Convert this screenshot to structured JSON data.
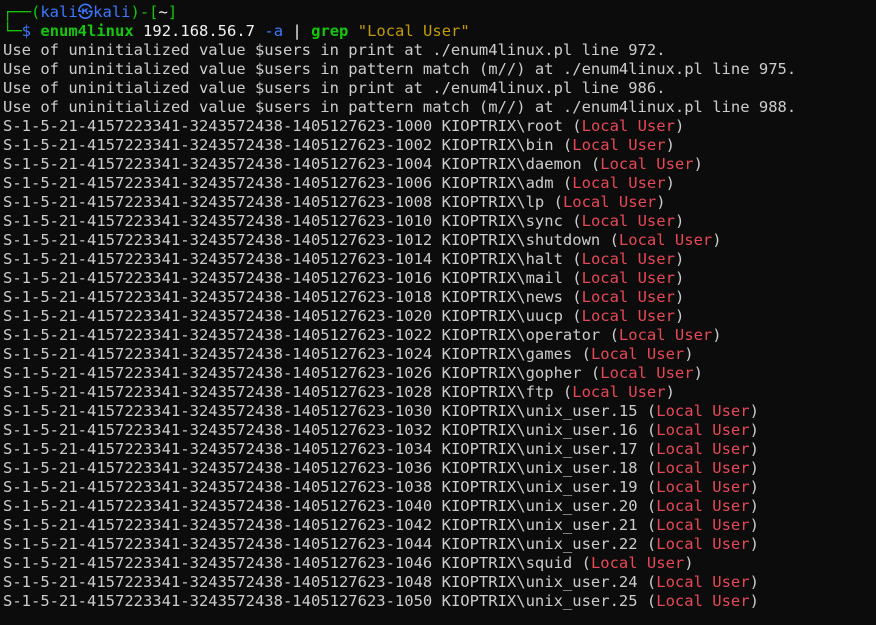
{
  "prompt": {
    "line1_prefix": "┌──(",
    "user": "kali",
    "at_symbol": "㉿",
    "host": "kali",
    "line1_mid": ")-[",
    "cwd": "~",
    "line1_suffix": "]",
    "line2_prefix": "└─",
    "dollar": "$",
    "cmd": "enum4linux",
    "arg_ip": "192.168.56.7",
    "arg_flag": "-a",
    "pipe": "|",
    "grep": "grep",
    "grep_pattern": "\"Local User\""
  },
  "warnings": [
    "Use of uninitialized value $users in print at ./enum4linux.pl line 972.",
    "Use of uninitialized value $users in pattern match (m//) at ./enum4linux.pl line 975.",
    "Use of uninitialized value $users in print at ./enum4linux.pl line 986.",
    "Use of uninitialized value $users in pattern match (m//) at ./enum4linux.pl line 988."
  ],
  "local_user_label": "Local User",
  "users": [
    {
      "sid": "S-1-5-21-4157223341-3243572438-1405127623-1000",
      "name": "KIOPTRIX\\root"
    },
    {
      "sid": "S-1-5-21-4157223341-3243572438-1405127623-1002",
      "name": "KIOPTRIX\\bin"
    },
    {
      "sid": "S-1-5-21-4157223341-3243572438-1405127623-1004",
      "name": "KIOPTRIX\\daemon"
    },
    {
      "sid": "S-1-5-21-4157223341-3243572438-1405127623-1006",
      "name": "KIOPTRIX\\adm"
    },
    {
      "sid": "S-1-5-21-4157223341-3243572438-1405127623-1008",
      "name": "KIOPTRIX\\lp"
    },
    {
      "sid": "S-1-5-21-4157223341-3243572438-1405127623-1010",
      "name": "KIOPTRIX\\sync"
    },
    {
      "sid": "S-1-5-21-4157223341-3243572438-1405127623-1012",
      "name": "KIOPTRIX\\shutdown"
    },
    {
      "sid": "S-1-5-21-4157223341-3243572438-1405127623-1014",
      "name": "KIOPTRIX\\halt"
    },
    {
      "sid": "S-1-5-21-4157223341-3243572438-1405127623-1016",
      "name": "KIOPTRIX\\mail"
    },
    {
      "sid": "S-1-5-21-4157223341-3243572438-1405127623-1018",
      "name": "KIOPTRIX\\news"
    },
    {
      "sid": "S-1-5-21-4157223341-3243572438-1405127623-1020",
      "name": "KIOPTRIX\\uucp"
    },
    {
      "sid": "S-1-5-21-4157223341-3243572438-1405127623-1022",
      "name": "KIOPTRIX\\operator"
    },
    {
      "sid": "S-1-5-21-4157223341-3243572438-1405127623-1024",
      "name": "KIOPTRIX\\games"
    },
    {
      "sid": "S-1-5-21-4157223341-3243572438-1405127623-1026",
      "name": "KIOPTRIX\\gopher"
    },
    {
      "sid": "S-1-5-21-4157223341-3243572438-1405127623-1028",
      "name": "KIOPTRIX\\ftp"
    },
    {
      "sid": "S-1-5-21-4157223341-3243572438-1405127623-1030",
      "name": "KIOPTRIX\\unix_user.15"
    },
    {
      "sid": "S-1-5-21-4157223341-3243572438-1405127623-1032",
      "name": "KIOPTRIX\\unix_user.16"
    },
    {
      "sid": "S-1-5-21-4157223341-3243572438-1405127623-1034",
      "name": "KIOPTRIX\\unix_user.17"
    },
    {
      "sid": "S-1-5-21-4157223341-3243572438-1405127623-1036",
      "name": "KIOPTRIX\\unix_user.18"
    },
    {
      "sid": "S-1-5-21-4157223341-3243572438-1405127623-1038",
      "name": "KIOPTRIX\\unix_user.19"
    },
    {
      "sid": "S-1-5-21-4157223341-3243572438-1405127623-1040",
      "name": "KIOPTRIX\\unix_user.20"
    },
    {
      "sid": "S-1-5-21-4157223341-3243572438-1405127623-1042",
      "name": "KIOPTRIX\\unix_user.21"
    },
    {
      "sid": "S-1-5-21-4157223341-3243572438-1405127623-1044",
      "name": "KIOPTRIX\\unix_user.22"
    },
    {
      "sid": "S-1-5-21-4157223341-3243572438-1405127623-1046",
      "name": "KIOPTRIX\\squid"
    },
    {
      "sid": "S-1-5-21-4157223341-3243572438-1405127623-1048",
      "name": "KIOPTRIX\\unix_user.24"
    },
    {
      "sid": "S-1-5-21-4157223341-3243572438-1405127623-1050",
      "name": "KIOPTRIX\\unix_user.25"
    }
  ],
  "colors": {
    "background": "#0c0c0c",
    "text": "#cccccc",
    "prompt_green": "#16c60c",
    "prompt_blue": "#3b78ff",
    "highlight_red": "#e74856",
    "string_yellow": "#c19c00"
  }
}
